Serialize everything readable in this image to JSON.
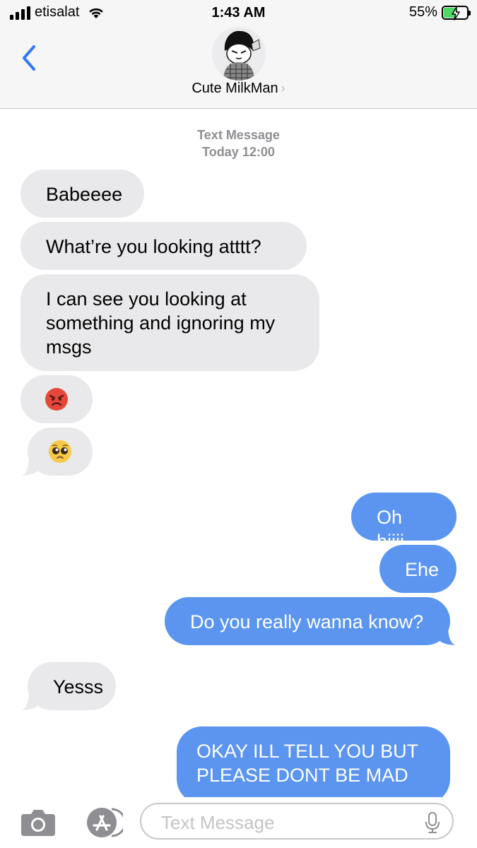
{
  "status_bar": {
    "carrier": "etisalat",
    "time": "1:43 AM",
    "battery_percent": "55%",
    "battery_level": 0.55
  },
  "header": {
    "contact_name": "Cute MilkMan",
    "avatar": "anime-character-avatar"
  },
  "thread": {
    "service_label": "Text Message",
    "timestamp": "Today 12:00"
  },
  "messages": [
    {
      "direction": "incoming",
      "text": "Babeeee"
    },
    {
      "direction": "incoming",
      "text": "What’re you looking atttt?"
    },
    {
      "direction": "incoming",
      "text": "I can see you looking at something and ignoring my msgs"
    },
    {
      "direction": "incoming",
      "text": "😡"
    },
    {
      "direction": "incoming",
      "text": "🥺"
    },
    {
      "direction": "outgoing",
      "text": "Oh hiiii"
    },
    {
      "direction": "outgoing",
      "text": "Ehe"
    },
    {
      "direction": "outgoing",
      "text": "Do you really wanna know?"
    },
    {
      "direction": "incoming",
      "text": "Yesss"
    },
    {
      "direction": "outgoing",
      "text": "OKAY ILL TELL YOU BUT PLEASE DONT BE MAD"
    }
  ],
  "compose": {
    "placeholder": "Text Message"
  },
  "icons": [
    "signal-icon",
    "wifi-icon",
    "battery-icon",
    "back-icon",
    "camera-icon",
    "app-store-icon",
    "mic-icon"
  ],
  "colors": {
    "incoming_bubble": "#e9e9eb",
    "outgoing_bubble": "#5b95f0",
    "accent": "#3478f6"
  }
}
